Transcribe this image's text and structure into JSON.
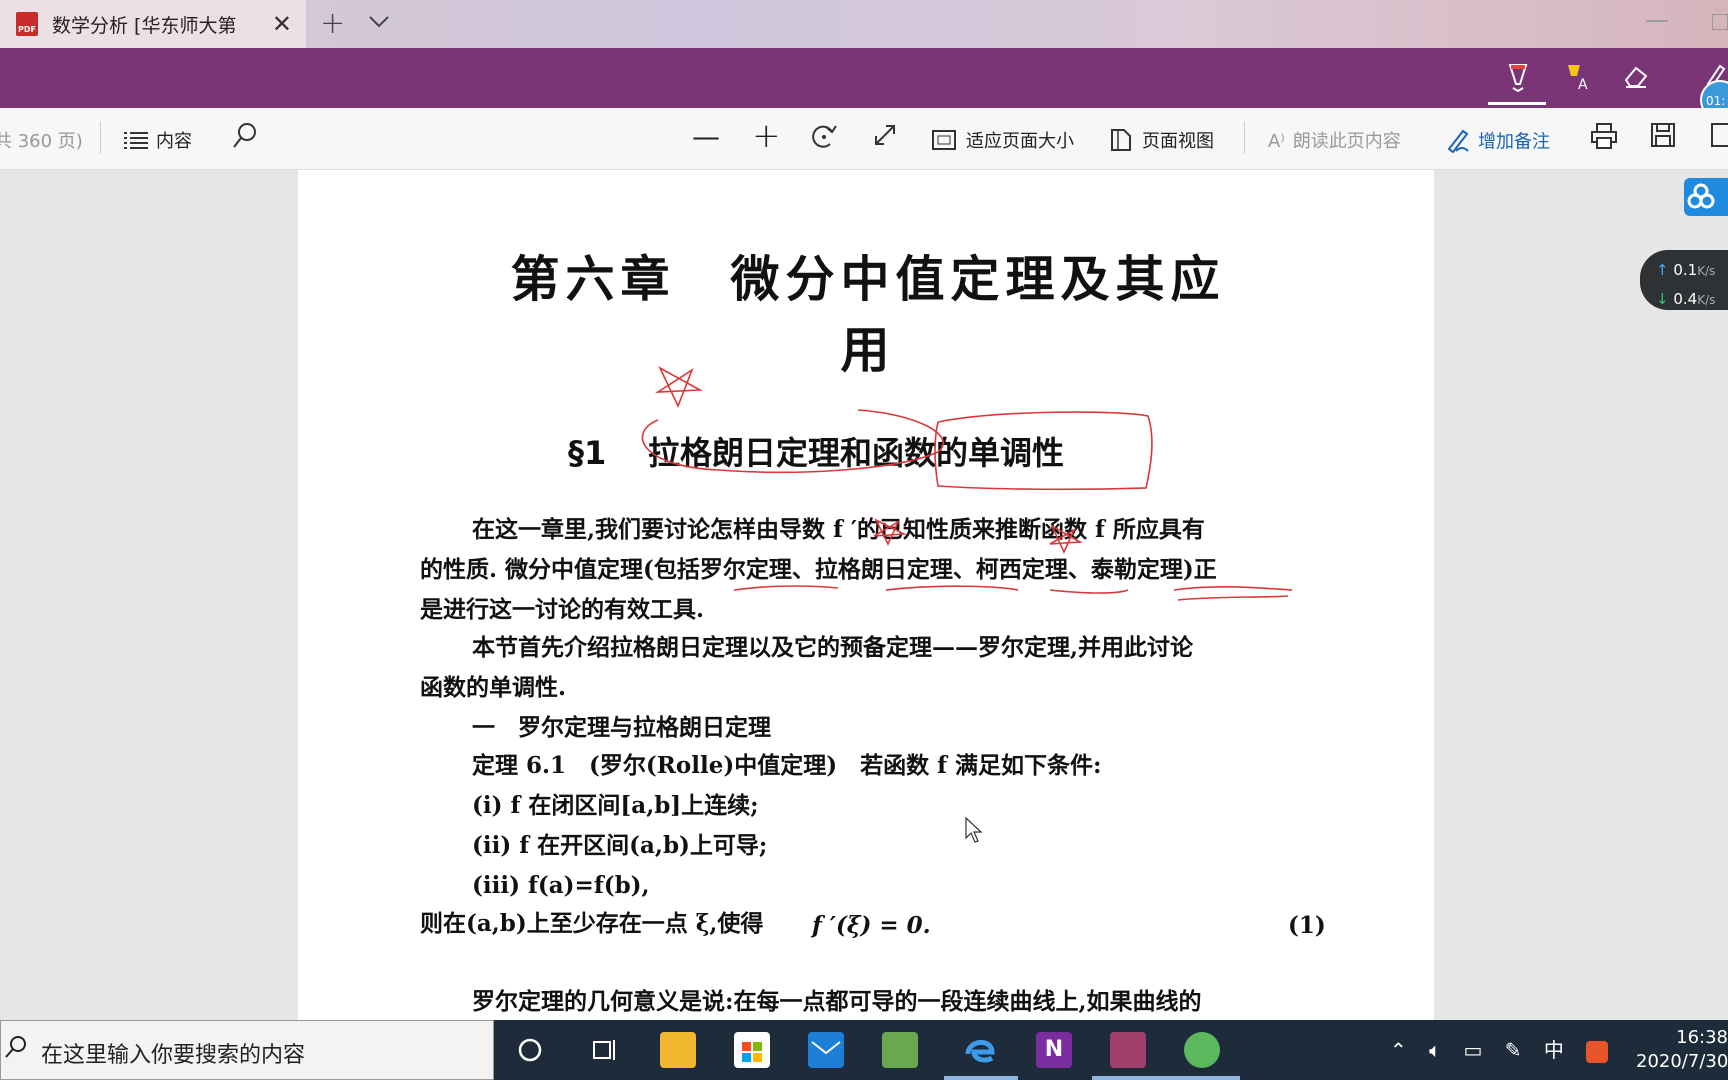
{
  "browser": {
    "tab_title": "数学分析 [华东师大第",
    "tab_icon": "pdf-icon",
    "tab_icon_text": "PDF",
    "new_tab": "+",
    "close": "✕"
  },
  "ink_toolbar": {
    "tools": [
      "ballpoint-pen-icon",
      "highlighter-icon",
      "eraser-icon"
    ],
    "clock_bubble": "01:"
  },
  "toolbar": {
    "page_count": "共 360 页)",
    "contents_label": "内容",
    "fit_page_label": "适应页面大小",
    "page_view_label": "页面视图",
    "read_aloud_label": "朗读此页内容",
    "add_note_label": "增加备注"
  },
  "document": {
    "chapter_title": "第六章　微分中值定理及其应用",
    "section_number": "§1",
    "section_title": "拉格朗日定理和函数的单调性",
    "lines": [
      "在这一章里,我们要讨论怎样由导数 f ′的已知性质来推断函数 f 所应具有",
      "的性质. 微分中值定理(包括罗尔定理、拉格朗日定理、柯西定理、泰勒定理)正",
      "是进行这一讨论的有效工具.",
      "本节首先介绍拉格朗日定理以及它的预备定理——罗尔定理,并用此讨论",
      "函数的单调性.",
      "一　罗尔定理与拉格朗日定理",
      "定理 6.1　(罗尔(Rolle)中值定理)　若函数 f 满足如下条件:",
      "(i) f 在闭区间[a,b]上连续;",
      "(ii) f 在开区间(a,b)上可导;",
      "(iii) f(a)=f(b),",
      "则在(a,b)上至少存在一点 ξ,使得",
      "罗尔定理的几何意义是说:在每一点都可导的一段连续曲线上,如果曲线的"
    ],
    "equation": "f ′(ξ) = 0.",
    "equation_number": "(1)"
  },
  "widgets": {
    "upload_speed": "0.1",
    "download_speed": "0.4",
    "speed_unit": "K/s"
  },
  "taskbar": {
    "search_placeholder": "在这里输入你要搜索的内容",
    "ime": "中",
    "time": "16:38",
    "date": "2020/7/30"
  },
  "colors": {
    "ink_bar": "#7a3577",
    "annotation_ink": "#d9383a",
    "accent": "#1a63b8"
  }
}
